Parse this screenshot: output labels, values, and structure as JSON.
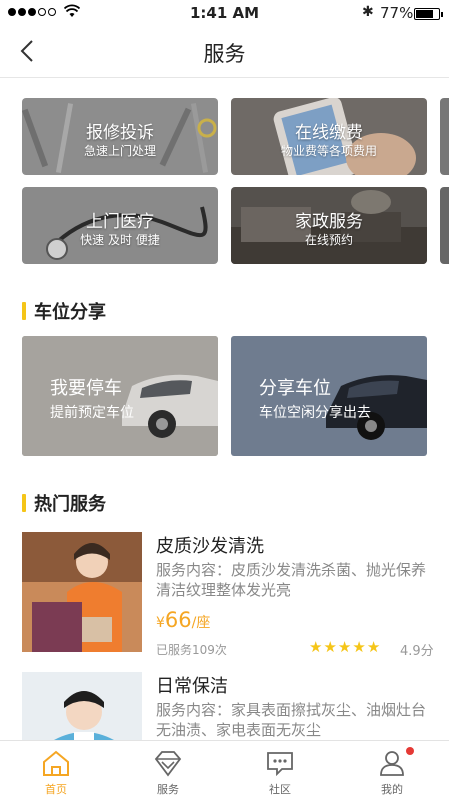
{
  "status": {
    "time": "1:41 AM",
    "battery": "77%",
    "battery_level": 0.77
  },
  "nav": {
    "title": "服务"
  },
  "tiles": [
    {
      "title": "报修投诉",
      "sub": "急速上门处理"
    },
    {
      "title": "在线缴费",
      "sub": "物业费等各项费用"
    },
    {
      "title": "上门医疗",
      "sub": "快速 及时 便捷"
    },
    {
      "title": "家政服务",
      "sub": "在线预约"
    }
  ],
  "parking": {
    "heading": "车位分享",
    "cards": [
      {
        "title": "我要停车",
        "sub": "提前预定车位"
      },
      {
        "title": "分享车位",
        "sub": "车位空闲分享出去"
      }
    ]
  },
  "hot": {
    "heading": "热门服务",
    "items": [
      {
        "name": "皮质沙发清洗",
        "desc": "服务内容：皮质沙发清洗杀菌、抛光保养清洁纹理整体发光亮",
        "price_sym": "¥",
        "price": "66",
        "unit": "/座",
        "served": "已服务109次",
        "rating": "4.9分",
        "stars": 5
      },
      {
        "name": "日常保洁",
        "desc": "服务内容：家具表面擦拭灰尘、油烟灶台无油渍、家电表面无灰尘"
      }
    ]
  },
  "tabbar": {
    "items": [
      "首页",
      "服务",
      "社区",
      "我的"
    ],
    "active": 0
  },
  "colors": {
    "accent": "#f5c518",
    "price": "#f5a623",
    "badge": "#e53935"
  }
}
